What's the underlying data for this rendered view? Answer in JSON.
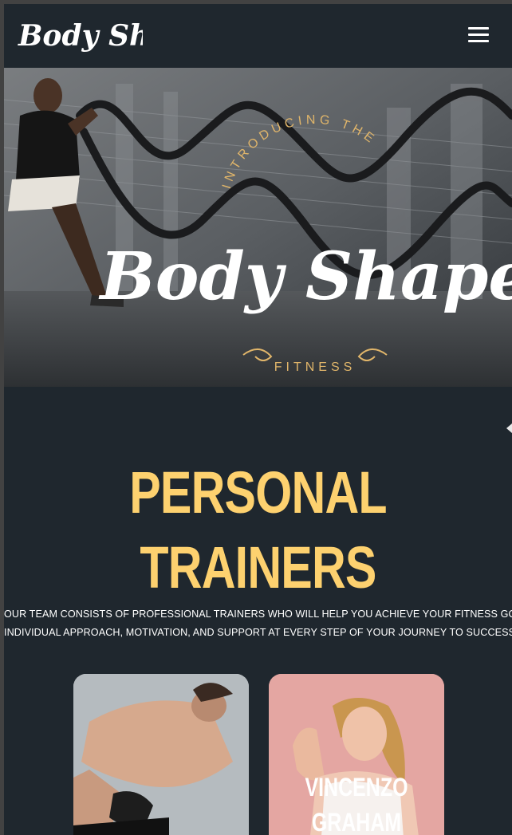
{
  "header": {
    "logo_text": "Body Shape",
    "menu_icon": "hamburger-menu-icon"
  },
  "hero": {
    "arc_text": "INTRODUCING THE",
    "brand_text": "Body Shape",
    "sub_text": "FITNESS"
  },
  "section": {
    "title_line1": "PERSONAL",
    "title_line2": "TRAINERS",
    "desc_line1": "OUR TEAM CONSISTS OF PROFESSIONAL TRAINERS WHO WILL HELP YOU ACHIEVE YOUR FITNESS GOALS.",
    "desc_line2": "INDIVIDUAL APPROACH, MOTIVATION, AND SUPPORT AT EVERY STEP OF YOUR JOURNEY TO SUCCESS."
  },
  "trainers": [
    {
      "name_line1": "",
      "name_line2": ""
    },
    {
      "name_line1": "VINCENZO",
      "name_line2": "GRAHAM"
    }
  ],
  "colors": {
    "background": "#1f272e",
    "accent": "#fdd16f",
    "text": "#ffffff"
  }
}
